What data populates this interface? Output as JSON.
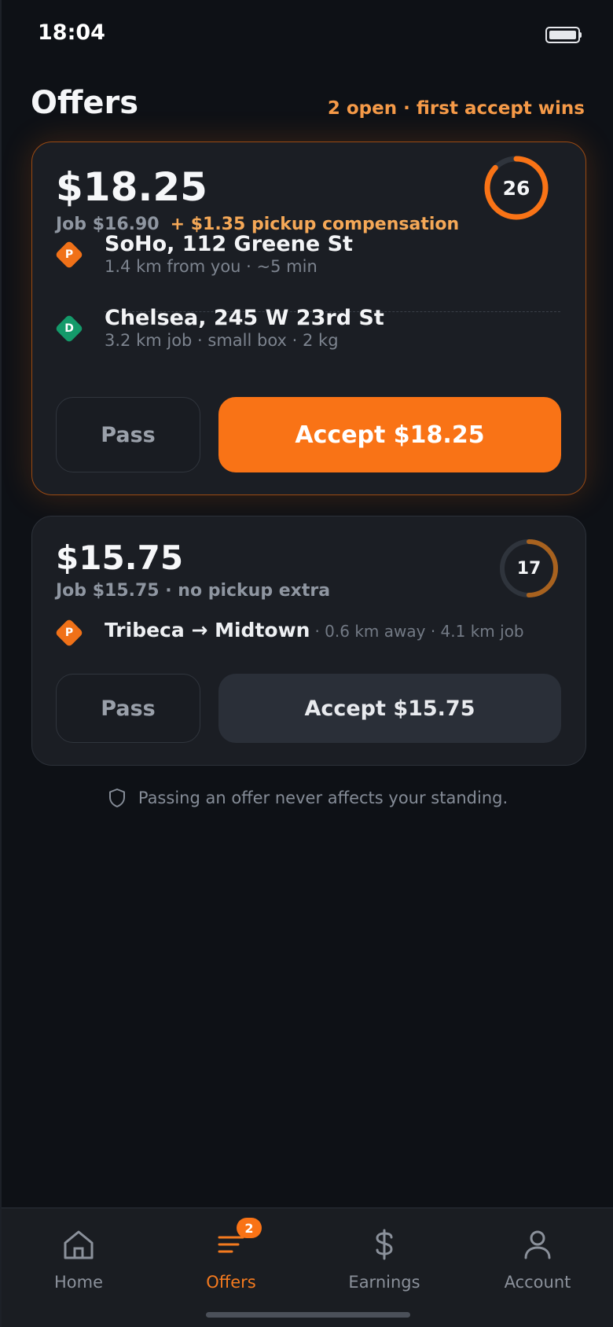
{
  "status_bar": {
    "time": "18:04"
  },
  "header": {
    "title": "Offers",
    "meta": "2 open · first accept wins"
  },
  "offers": [
    {
      "price": "$18.25",
      "job_text": "Job $16.90",
      "compensation_text": "+ $1.35 pickup compensation",
      "timer": {
        "seconds": "26",
        "remaining_fraction": 0.87,
        "color": "#f97316"
      },
      "pickup": {
        "marker": "P",
        "name": "SoHo, 112 Greene St",
        "detail": "1.4 km from you · ~5 min"
      },
      "dropoff": {
        "marker": "D",
        "name": "Chelsea, 245 W 23rd St",
        "detail": "3.2 km job · small box · 2 kg"
      },
      "pass_label": "Pass",
      "accept_label": "Accept $18.25"
    },
    {
      "price": "$15.75",
      "job_text": "Job $15.75 · no pickup extra",
      "timer": {
        "seconds": "17",
        "remaining_fraction": 0.5,
        "color": "#a8621f"
      },
      "route": {
        "marker": "P",
        "name": "Tribeca → Midtown",
        "detail": "· 0.6 km away · 4.1 km job"
      },
      "pass_label": "Pass",
      "accept_label": "Accept $15.75"
    }
  ],
  "footer_note": "Passing an offer never affects your standing.",
  "nav": {
    "items": [
      {
        "label": "Home",
        "icon": "home-icon"
      },
      {
        "label": "Offers",
        "icon": "offers-list-icon",
        "badge": "2",
        "active": true
      },
      {
        "label": "Earnings",
        "icon": "dollar-icon"
      },
      {
        "label": "Account",
        "icon": "user-icon"
      }
    ]
  },
  "colors": {
    "accent": "#f97316",
    "pickup": "#f07118",
    "dropoff": "#149a6a",
    "background": "#0e1116",
    "card": "#1b1e24"
  }
}
